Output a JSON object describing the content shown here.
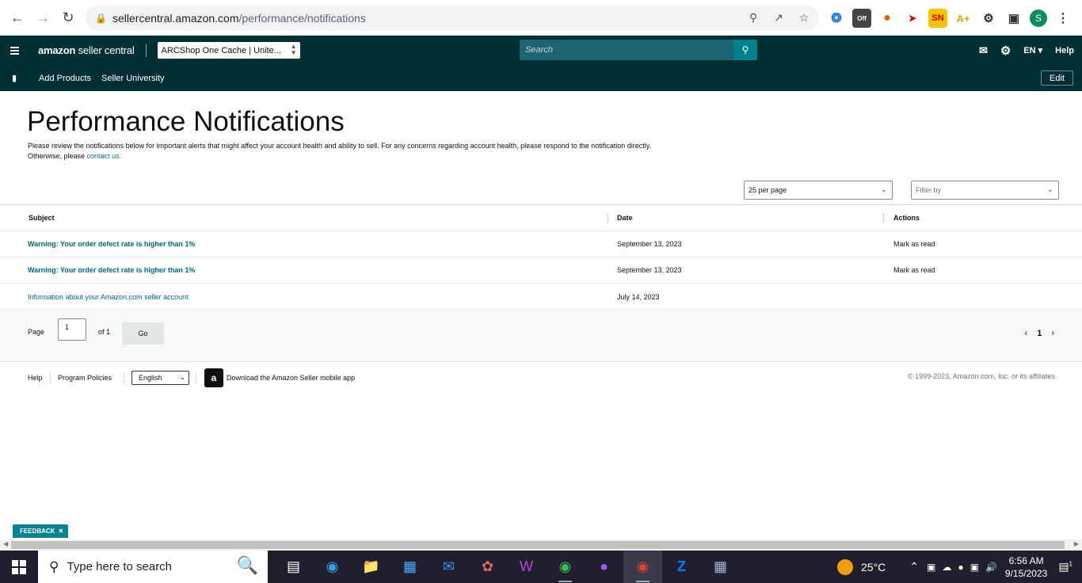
{
  "browser": {
    "url_host": "sellercentral.amazon.com",
    "url_path": "/performance/notifications",
    "profile_initial": "S",
    "extensions": [
      "SN",
      "Off"
    ]
  },
  "header": {
    "logo_brand": "amazon",
    "logo_text": "seller central",
    "store": "ARCShop One Cache | Unite...",
    "search_placeholder": "Search",
    "language": "EN",
    "help": "Help"
  },
  "subnav": {
    "items": [
      "Add Products",
      "Seller University"
    ],
    "edit": "Edit"
  },
  "page": {
    "title": "Performance Notifications",
    "description_line1": "Please review the notifications below for important alerts that might affect your account health and ability to sell. For any concerns regarding account health, please respond to the notification directly.",
    "description_line2_prefix": "Otherwise, please ",
    "description_link": "contact us.",
    "per_page": "25 per page",
    "filter_placeholder": "Filter by"
  },
  "table": {
    "headers": [
      "Subject",
      "Date",
      "Actions"
    ],
    "rows": [
      {
        "subject": "Warning: Your order defect rate is higher than 1%",
        "date": "September 13, 2023",
        "action": "Mark as read"
      },
      {
        "subject": "Warning: Your order defect rate is higher than 1%",
        "date": "September 13, 2023",
        "action": "Mark as read"
      },
      {
        "subject": "Information about your Amazon.com seller account",
        "date": "July 14, 2023",
        "action": ""
      }
    ]
  },
  "pager": {
    "page_label": "Page",
    "page_value": "1",
    "of_label": "of 1",
    "go": "Go",
    "current": "1"
  },
  "footer": {
    "help": "Help",
    "policies": "Program Policies",
    "language": "English",
    "app_text": "Download the Amazon Seller mobile app",
    "copyright": "© 1999-2023, Amazon.com, Inc. or its affiliates"
  },
  "feedback": "FEEDBACK",
  "taskbar": {
    "search_placeholder": "Type here to search",
    "temperature": "25°C",
    "time": "6:56 AM",
    "date": "9/15/2023",
    "notification_count": "1"
  }
}
